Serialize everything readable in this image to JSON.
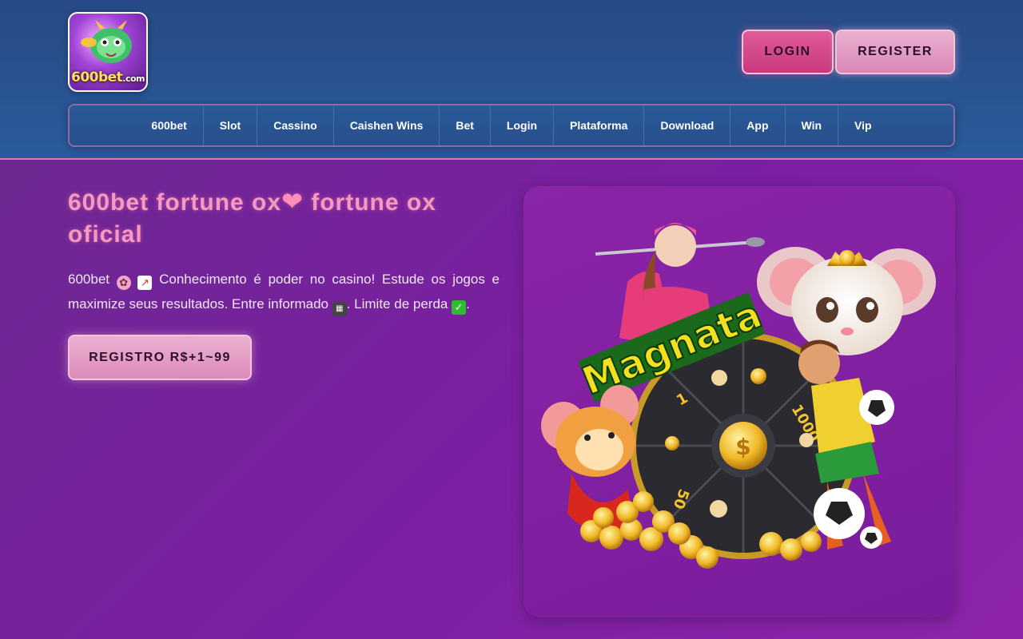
{
  "header": {
    "logo": {
      "brand": "600bet",
      "tld": ".com"
    },
    "login_label": "LOGIN",
    "register_label": "REGISTER"
  },
  "nav": {
    "items": [
      "600bet",
      "Slot",
      "Cassino",
      "Caishen Wins",
      "Bet",
      "Login",
      "Plataforma",
      "Download",
      "App",
      "Win",
      "Vip"
    ]
  },
  "hero": {
    "title_part1": "600bet fortune ox",
    "title_heart": "❤",
    "title_part2": "fortune ox oficial",
    "desc_1": "600bet",
    "desc_2": "Conhecimento é poder no casino! Estude os jogos e maximize seus resultados. Entre informado",
    "desc_3": ". Limite de perda",
    "desc_4": ".",
    "cta_label": "REGISTRO R$+1~99"
  },
  "promo": {
    "banner_text": "Magnata",
    "wheel_labels": [
      "1000",
      "50",
      "1"
    ]
  },
  "colors": {
    "header_bg": "#274a85",
    "page_bg": "#7b1fa2",
    "accent_pink": "#e05b97",
    "title_pink": "#f49ac1"
  }
}
